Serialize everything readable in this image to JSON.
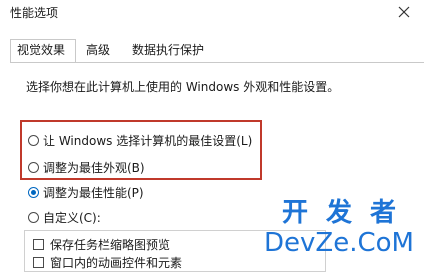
{
  "window": {
    "title": "性能选项"
  },
  "tabs": [
    {
      "label": "视觉效果"
    },
    {
      "label": "高级"
    },
    {
      "label": "数据执行保护"
    }
  ],
  "description": "选择你想在此计算机上使用的 Windows 外观和性能设置。",
  "options": [
    {
      "label": "让 Windows 选择计算机的最佳设置(L)",
      "checked": false
    },
    {
      "label": "调整为最佳外观(B)",
      "checked": false
    },
    {
      "label": "调整为最佳性能(P)",
      "checked": true
    },
    {
      "label": "自定义(C):",
      "checked": false
    }
  ],
  "effects": [
    {
      "label": "保存任务栏缩略图预览"
    },
    {
      "label": "窗口内的动画控件和元素"
    }
  ],
  "watermark": {
    "line1": "开发者",
    "line2": "DevZe.CoM"
  },
  "colors": {
    "highlight": "#c0392b",
    "accent": "#0067c0",
    "watermark": "#1e74d6"
  }
}
